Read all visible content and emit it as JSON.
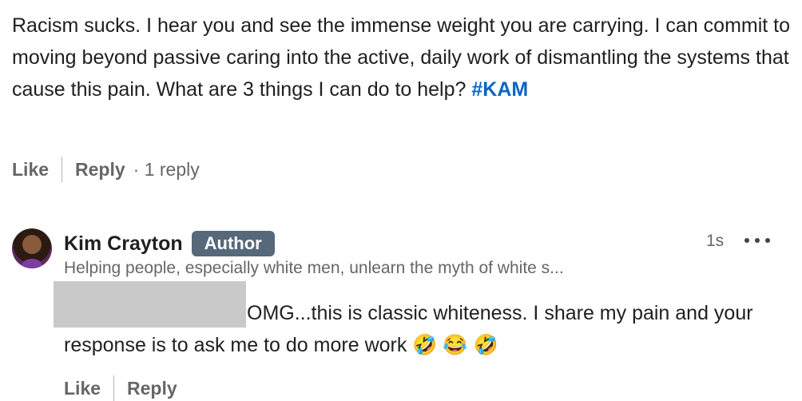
{
  "comment": {
    "text": "Racism sucks. I hear you and see the immense weight you are carrying. I can commit to moving beyond passive caring into the active, daily work of dismantling the systems that cause this pain. What are 3 things I can do to help? ",
    "hashtag": "#KAM",
    "actions": {
      "like_label": "Like",
      "reply_label": "Reply",
      "reply_count": "· 1 reply"
    }
  },
  "reply": {
    "author_name": "Kim Crayton",
    "author_badge": "Author",
    "headline": "Helping people, especially white men, unlearn the myth of white s...",
    "timestamp": "1s",
    "text": "OMG...this is classic whiteness. I share my pain and your response is to ask me to do more work 🤣 😂 🤣",
    "actions": {
      "like_label": "Like",
      "reply_label": "Reply"
    }
  },
  "colors": {
    "hashtag": "#0a66c2",
    "badge_bg": "#56687a",
    "muted_text": "#666666"
  }
}
